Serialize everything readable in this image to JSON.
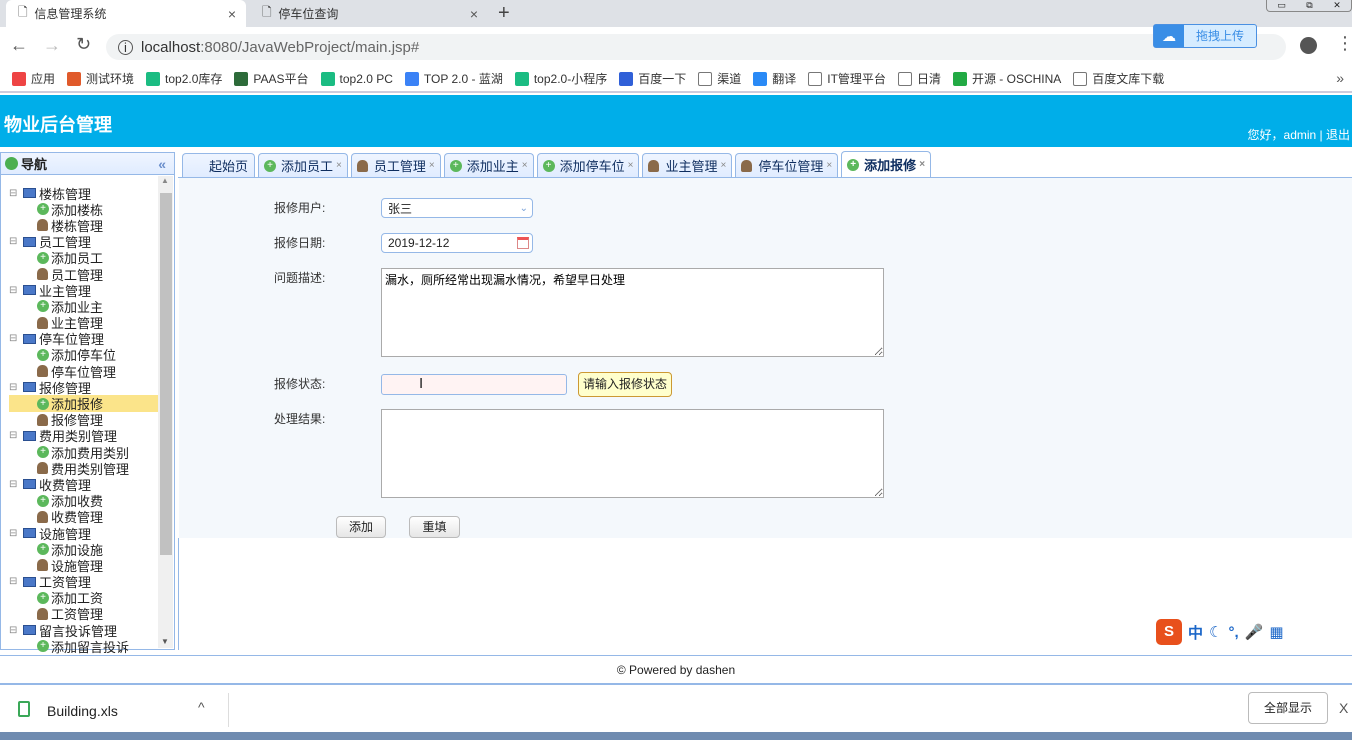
{
  "browser": {
    "tabs": [
      {
        "label": "信息管理系统",
        "active": true
      },
      {
        "label": "停车位查询",
        "active": false
      }
    ],
    "url_host": "localhost",
    "url_rest": ":8080/JavaWebProject/main.jsp#",
    "baidu_upload": "拖拽上传",
    "bookmarks": [
      {
        "label": "应用",
        "color": "#e44"
      },
      {
        "label": "测试环境",
        "color": "#e05a2b"
      },
      {
        "label": "top2.0库存",
        "color": "#1bbc82"
      },
      {
        "label": "PAAS平台",
        "color": "#2d6b3a"
      },
      {
        "label": "top2.0 PC",
        "color": "#1bbc82"
      },
      {
        "label": "TOP 2.0 - 蓝湖",
        "color": "#3b82f6"
      },
      {
        "label": "top2.0-小程序",
        "color": "#1bbc82"
      },
      {
        "label": "百度一下",
        "color": "#3060d8"
      },
      {
        "label": "渠道",
        "color": "#fff"
      },
      {
        "label": "翻译",
        "color": "#2a8af6"
      },
      {
        "label": "IT管理平台",
        "color": "#fff"
      },
      {
        "label": "日清",
        "color": "#fff"
      },
      {
        "label": "开源 - OSCHINA",
        "color": "#22aa44"
      },
      {
        "label": "百度文库下载",
        "color": "#fff"
      }
    ],
    "more": "»"
  },
  "header": {
    "title": "物业后台管理",
    "user": "您好，admin | 退出",
    "color": "#00aee9"
  },
  "nav": {
    "title": "导航",
    "collapse": "«",
    "groups": [
      {
        "label": "楼栋管理",
        "children": [
          "添加楼栋",
          "楼栋管理"
        ]
      },
      {
        "label": "员工管理",
        "children": [
          "添加员工",
          "员工管理"
        ]
      },
      {
        "label": "业主管理",
        "children": [
          "添加业主",
          "业主管理"
        ]
      },
      {
        "label": "停车位管理",
        "children": [
          "添加停车位",
          "停车位管理"
        ]
      },
      {
        "label": "报修管理",
        "children": [
          "添加报修",
          "报修管理"
        ]
      },
      {
        "label": "费用类别管理",
        "children": [
          "添加费用类别",
          "费用类别管理"
        ]
      },
      {
        "label": "收费管理",
        "children": [
          "添加收费",
          "收费管理"
        ]
      },
      {
        "label": "设施管理",
        "children": [
          "添加设施",
          "设施管理"
        ]
      },
      {
        "label": "工资管理",
        "children": [
          "添加工资",
          "工资管理"
        ]
      },
      {
        "label": "留言投诉管理",
        "children": [
          "添加留言投诉"
        ]
      }
    ],
    "selected": "添加报修"
  },
  "tabs": [
    {
      "label": "起始页",
      "icon": "none",
      "closable": false
    },
    {
      "label": "添加员工",
      "icon": "plus",
      "closable": true
    },
    {
      "label": "员工管理",
      "icon": "person",
      "closable": true
    },
    {
      "label": "添加业主",
      "icon": "plus",
      "closable": true
    },
    {
      "label": "添加停车位",
      "icon": "plus",
      "closable": true
    },
    {
      "label": "业主管理",
      "icon": "person",
      "closable": true
    },
    {
      "label": "停车位管理",
      "icon": "person",
      "closable": true
    },
    {
      "label": "添加报修",
      "icon": "plus",
      "closable": true,
      "active": true
    }
  ],
  "form": {
    "user_label": "报修用户:",
    "user_value": "张三",
    "date_label": "报修日期:",
    "date_value": "2019-12-12",
    "desc_label": "问题描述:",
    "desc_value": "漏水，厕所经常出现漏水情况，希望早日处理",
    "status_label": "报修状态:",
    "status_value": "",
    "status_tip": "请输入报修状态",
    "result_label": "处理结果:",
    "result_value": "",
    "add": "添加",
    "reset": "重填"
  },
  "footer": "© Powered by dashen",
  "download": {
    "file": "Building.xls",
    "show_all": "全部显示",
    "close": "X"
  },
  "ime": {
    "label": "中"
  }
}
